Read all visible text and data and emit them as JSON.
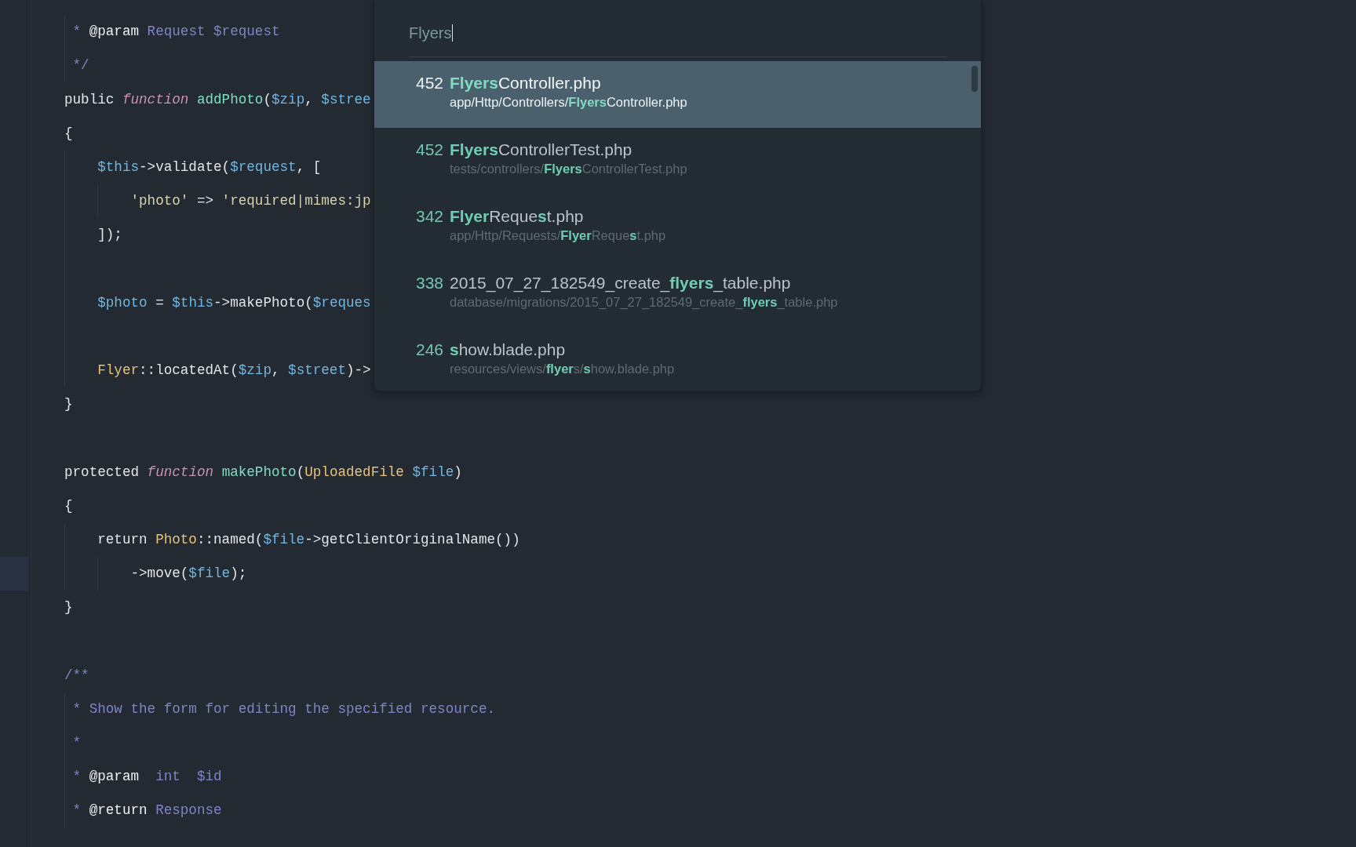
{
  "editor": {
    "lines": [
      {
        "current": false,
        "tokens": [
          {
            "kind": "comment",
            "text": " * "
          },
          {
            "kind": "doctag",
            "text": "@param"
          },
          {
            "kind": "comment",
            "text": " Request $request"
          }
        ]
      },
      {
        "current": false,
        "tokens": [
          {
            "kind": "comment",
            "text": " */"
          }
        ]
      },
      {
        "current": false,
        "tokens": [
          {
            "kind": "plain",
            "text": "public "
          },
          {
            "kind": "storage",
            "text": "function "
          },
          {
            "kind": "entity",
            "text": "addPhoto"
          },
          {
            "kind": "plain",
            "text": "("
          },
          {
            "kind": "variable",
            "text": "$zip"
          },
          {
            "kind": "plain",
            "text": ", "
          },
          {
            "kind": "variable",
            "text": "$stree"
          }
        ]
      },
      {
        "current": false,
        "tokens": [
          {
            "kind": "plain",
            "text": "{"
          }
        ]
      },
      {
        "current": false,
        "tokens": [
          {
            "kind": "variable",
            "text": "    $this"
          },
          {
            "kind": "plain",
            "text": "->validate("
          },
          {
            "kind": "variable",
            "text": "$request"
          },
          {
            "kind": "plain",
            "text": ", ["
          }
        ]
      },
      {
        "current": false,
        "tokens": [
          {
            "kind": "string",
            "text": "        'photo'"
          },
          {
            "kind": "plain",
            "text": " => "
          },
          {
            "kind": "string",
            "text": "'required|mimes:jp"
          }
        ]
      },
      {
        "current": false,
        "tokens": [
          {
            "kind": "plain",
            "text": "    ]);"
          }
        ]
      },
      {
        "current": false
      },
      {
        "current": false,
        "tokens": [
          {
            "kind": "variable",
            "text": "    $photo"
          },
          {
            "kind": "plain",
            "text": " = "
          },
          {
            "kind": "variable",
            "text": "$this"
          },
          {
            "kind": "plain",
            "text": "->makePhoto("
          },
          {
            "kind": "variable",
            "text": "$reques"
          }
        ]
      },
      {
        "current": false
      },
      {
        "current": false,
        "tokens": [
          {
            "kind": "class",
            "text": "    Flyer"
          },
          {
            "kind": "plain",
            "text": "::locatedAt("
          },
          {
            "kind": "variable",
            "text": "$zip"
          },
          {
            "kind": "plain",
            "text": ", "
          },
          {
            "kind": "variable",
            "text": "$street"
          },
          {
            "kind": "plain",
            "text": ")->"
          }
        ]
      },
      {
        "current": false,
        "tokens": [
          {
            "kind": "plain",
            "text": "}"
          }
        ]
      },
      {
        "current": false
      },
      {
        "current": false,
        "tokens": [
          {
            "kind": "plain",
            "text": "protected "
          },
          {
            "kind": "storage",
            "text": "function "
          },
          {
            "kind": "entity",
            "text": "makePhoto"
          },
          {
            "kind": "plain",
            "text": "("
          },
          {
            "kind": "class",
            "text": "UploadedFile "
          },
          {
            "kind": "variable",
            "text": "$file"
          },
          {
            "kind": "plain",
            "text": ")"
          }
        ]
      },
      {
        "current": false,
        "tokens": [
          {
            "kind": "plain",
            "text": "{"
          }
        ]
      },
      {
        "current": false,
        "tokens": [
          {
            "kind": "plain",
            "text": "    return "
          },
          {
            "kind": "class",
            "text": "Photo"
          },
          {
            "kind": "plain",
            "text": "::named("
          },
          {
            "kind": "variable",
            "text": "$file"
          },
          {
            "kind": "plain",
            "text": "->getClientOriginalName())"
          }
        ]
      },
      {
        "current": true,
        "tokens": [
          {
            "kind": "plain",
            "text": "        ->move("
          },
          {
            "kind": "variable",
            "text": "$file"
          },
          {
            "kind": "plain",
            "text": ");"
          }
        ]
      },
      {
        "current": false,
        "tokens": [
          {
            "kind": "plain",
            "text": "}"
          }
        ]
      },
      {
        "current": false
      },
      {
        "current": false,
        "tokens": [
          {
            "kind": "comment",
            "text": "/**"
          }
        ]
      },
      {
        "current": false,
        "tokens": [
          {
            "kind": "comment",
            "text": " * Show the form for editing the specified resource."
          }
        ]
      },
      {
        "current": false,
        "tokens": [
          {
            "kind": "comment",
            "text": " *"
          }
        ]
      },
      {
        "current": false,
        "tokens": [
          {
            "kind": "comment",
            "text": " * "
          },
          {
            "kind": "doctag",
            "text": "@param"
          },
          {
            "kind": "comment",
            "text": "  int  $id"
          }
        ]
      },
      {
        "current": false,
        "tokens": [
          {
            "kind": "comment",
            "text": " * "
          },
          {
            "kind": "doctag",
            "text": "@return"
          },
          {
            "kind": "comment",
            "text": " Response"
          }
        ]
      }
    ]
  },
  "palette": {
    "search": {
      "value": "Flyers",
      "focused": true
    },
    "results": [
      {
        "score": "452",
        "name": "**Flyers**Controller.php",
        "path": "app/Http/Controllers/**Flyers**Controller.php",
        "selected": true
      },
      {
        "score": "452",
        "name": "**Flyers**ControllerTest.php",
        "path": "tests/controllers/**Flyers**ControllerTest.php",
        "selected": false
      },
      {
        "score": "342",
        "name": "**Flyer**Reque**s**t.php",
        "path": "app/Http/Requests/**Flyer**Reque**s**t.php",
        "selected": false
      },
      {
        "score": "338",
        "name": "2015_07_27_182549_create_**flyers**_table.php",
        "path": "database/migrations/2015_07_27_182549_create_**flyers**_table.php",
        "selected": false
      },
      {
        "score": "246",
        "name": "**s**how.blade.php",
        "path": "resources/views/**flyer**s/**s**how.blade.php",
        "selected": false
      }
    ]
  }
}
